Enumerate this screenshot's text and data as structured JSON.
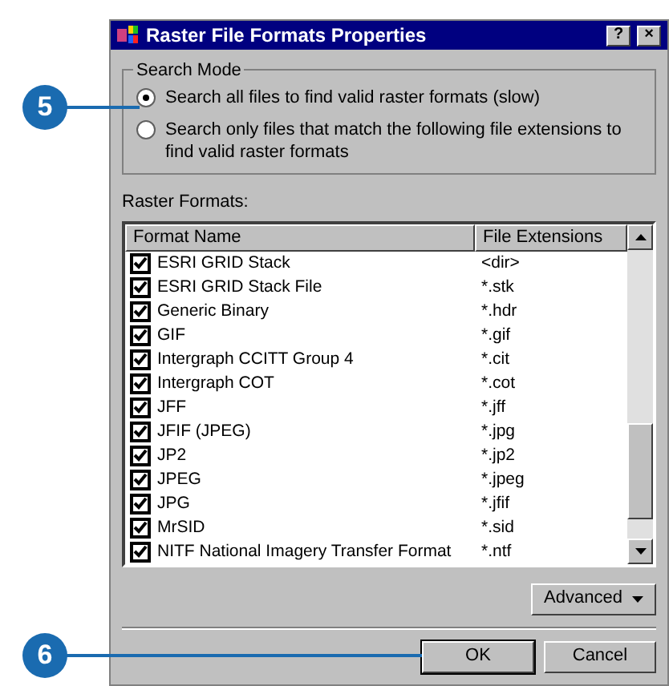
{
  "window": {
    "title": "Raster File Formats Properties",
    "buttons": [
      "?",
      "×"
    ]
  },
  "search_mode": {
    "title": "Search Mode",
    "options": [
      {
        "label": "Search all files to find valid raster formats (slow)",
        "selected": true
      },
      {
        "label": "Search only files that match the following file extensions to find valid raster formats",
        "selected": false
      }
    ]
  },
  "raster_formats": {
    "label": "Raster Formats:",
    "columns": [
      "Format Name",
      "File Extensions"
    ],
    "rows": [
      {
        "name": "ESRI GRID Stack",
        "ext": "<dir>",
        "checked": true
      },
      {
        "name": "ESRI GRID Stack File",
        "ext": "*.stk",
        "checked": true
      },
      {
        "name": "Generic Binary",
        "ext": "*.hdr",
        "checked": true
      },
      {
        "name": "GIF",
        "ext": "*.gif",
        "checked": true
      },
      {
        "name": "Intergraph CCITT Group 4",
        "ext": "*.cit",
        "checked": true
      },
      {
        "name": "Intergraph COT",
        "ext": "*.cot",
        "checked": true
      },
      {
        "name": "JFF",
        "ext": "*.jff",
        "checked": true
      },
      {
        "name": "JFIF (JPEG)",
        "ext": "*.jpg",
        "checked": true
      },
      {
        "name": "JP2",
        "ext": "*.jp2",
        "checked": true
      },
      {
        "name": "JPEG",
        "ext": "*.jpeg",
        "checked": true
      },
      {
        "name": "JPG",
        "ext": "*.jfif",
        "checked": true
      },
      {
        "name": "MrSID",
        "ext": "*.sid",
        "checked": true
      },
      {
        "name": "NITF National Imagery Transfer Format",
        "ext": "*.ntf",
        "checked": true
      }
    ]
  },
  "advanced_button": "Advanced",
  "buttons": [
    "OK",
    "Cancel"
  ],
  "callouts": [
    "5",
    "6"
  ]
}
